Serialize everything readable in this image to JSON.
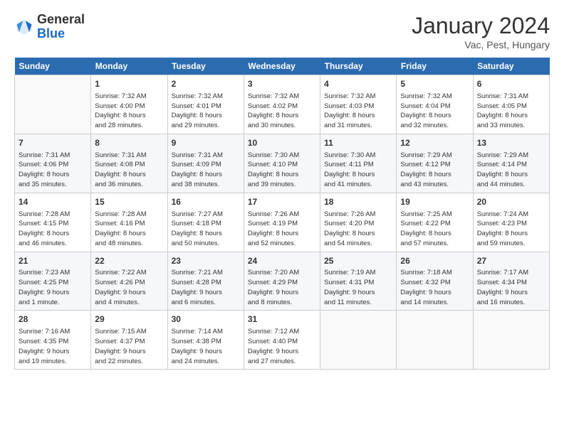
{
  "header": {
    "logo_general": "General",
    "logo_blue": "Blue",
    "month_year": "January 2024",
    "location": "Vac, Pest, Hungary"
  },
  "days_of_week": [
    "Sunday",
    "Monday",
    "Tuesday",
    "Wednesday",
    "Thursday",
    "Friday",
    "Saturday"
  ],
  "weeks": [
    [
      {
        "day": "",
        "info": ""
      },
      {
        "day": "1",
        "info": "Sunrise: 7:32 AM\nSunset: 4:00 PM\nDaylight: 8 hours\nand 28 minutes."
      },
      {
        "day": "2",
        "info": "Sunrise: 7:32 AM\nSunset: 4:01 PM\nDaylight: 8 hours\nand 29 minutes."
      },
      {
        "day": "3",
        "info": "Sunrise: 7:32 AM\nSunset: 4:02 PM\nDaylight: 8 hours\nand 30 minutes."
      },
      {
        "day": "4",
        "info": "Sunrise: 7:32 AM\nSunset: 4:03 PM\nDaylight: 8 hours\nand 31 minutes."
      },
      {
        "day": "5",
        "info": "Sunrise: 7:32 AM\nSunset: 4:04 PM\nDaylight: 8 hours\nand 32 minutes."
      },
      {
        "day": "6",
        "info": "Sunrise: 7:31 AM\nSunset: 4:05 PM\nDaylight: 8 hours\nand 33 minutes."
      }
    ],
    [
      {
        "day": "7",
        "info": "Sunrise: 7:31 AM\nSunset: 4:06 PM\nDaylight: 8 hours\nand 35 minutes."
      },
      {
        "day": "8",
        "info": "Sunrise: 7:31 AM\nSunset: 4:08 PM\nDaylight: 8 hours\nand 36 minutes."
      },
      {
        "day": "9",
        "info": "Sunrise: 7:31 AM\nSunset: 4:09 PM\nDaylight: 8 hours\nand 38 minutes."
      },
      {
        "day": "10",
        "info": "Sunrise: 7:30 AM\nSunset: 4:10 PM\nDaylight: 8 hours\nand 39 minutes."
      },
      {
        "day": "11",
        "info": "Sunrise: 7:30 AM\nSunset: 4:11 PM\nDaylight: 8 hours\nand 41 minutes."
      },
      {
        "day": "12",
        "info": "Sunrise: 7:29 AM\nSunset: 4:12 PM\nDaylight: 8 hours\nand 43 minutes."
      },
      {
        "day": "13",
        "info": "Sunrise: 7:29 AM\nSunset: 4:14 PM\nDaylight: 8 hours\nand 44 minutes."
      }
    ],
    [
      {
        "day": "14",
        "info": "Sunrise: 7:28 AM\nSunset: 4:15 PM\nDaylight: 8 hours\nand 46 minutes."
      },
      {
        "day": "15",
        "info": "Sunrise: 7:28 AM\nSunset: 4:16 PM\nDaylight: 8 hours\nand 48 minutes."
      },
      {
        "day": "16",
        "info": "Sunrise: 7:27 AM\nSunset: 4:18 PM\nDaylight: 8 hours\nand 50 minutes."
      },
      {
        "day": "17",
        "info": "Sunrise: 7:26 AM\nSunset: 4:19 PM\nDaylight: 8 hours\nand 52 minutes."
      },
      {
        "day": "18",
        "info": "Sunrise: 7:26 AM\nSunset: 4:20 PM\nDaylight: 8 hours\nand 54 minutes."
      },
      {
        "day": "19",
        "info": "Sunrise: 7:25 AM\nSunset: 4:22 PM\nDaylight: 8 hours\nand 57 minutes."
      },
      {
        "day": "20",
        "info": "Sunrise: 7:24 AM\nSunset: 4:23 PM\nDaylight: 8 hours\nand 59 minutes."
      }
    ],
    [
      {
        "day": "21",
        "info": "Sunrise: 7:23 AM\nSunset: 4:25 PM\nDaylight: 9 hours\nand 1 minute."
      },
      {
        "day": "22",
        "info": "Sunrise: 7:22 AM\nSunset: 4:26 PM\nDaylight: 9 hours\nand 4 minutes."
      },
      {
        "day": "23",
        "info": "Sunrise: 7:21 AM\nSunset: 4:28 PM\nDaylight: 9 hours\nand 6 minutes."
      },
      {
        "day": "24",
        "info": "Sunrise: 7:20 AM\nSunset: 4:29 PM\nDaylight: 9 hours\nand 8 minutes."
      },
      {
        "day": "25",
        "info": "Sunrise: 7:19 AM\nSunset: 4:31 PM\nDaylight: 9 hours\nand 11 minutes."
      },
      {
        "day": "26",
        "info": "Sunrise: 7:18 AM\nSunset: 4:32 PM\nDaylight: 9 hours\nand 14 minutes."
      },
      {
        "day": "27",
        "info": "Sunrise: 7:17 AM\nSunset: 4:34 PM\nDaylight: 9 hours\nand 16 minutes."
      }
    ],
    [
      {
        "day": "28",
        "info": "Sunrise: 7:16 AM\nSunset: 4:35 PM\nDaylight: 9 hours\nand 19 minutes."
      },
      {
        "day": "29",
        "info": "Sunrise: 7:15 AM\nSunset: 4:37 PM\nDaylight: 9 hours\nand 22 minutes."
      },
      {
        "day": "30",
        "info": "Sunrise: 7:14 AM\nSunset: 4:38 PM\nDaylight: 9 hours\nand 24 minutes."
      },
      {
        "day": "31",
        "info": "Sunrise: 7:12 AM\nSunset: 4:40 PM\nDaylight: 9 hours\nand 27 minutes."
      },
      {
        "day": "",
        "info": ""
      },
      {
        "day": "",
        "info": ""
      },
      {
        "day": "",
        "info": ""
      }
    ]
  ]
}
